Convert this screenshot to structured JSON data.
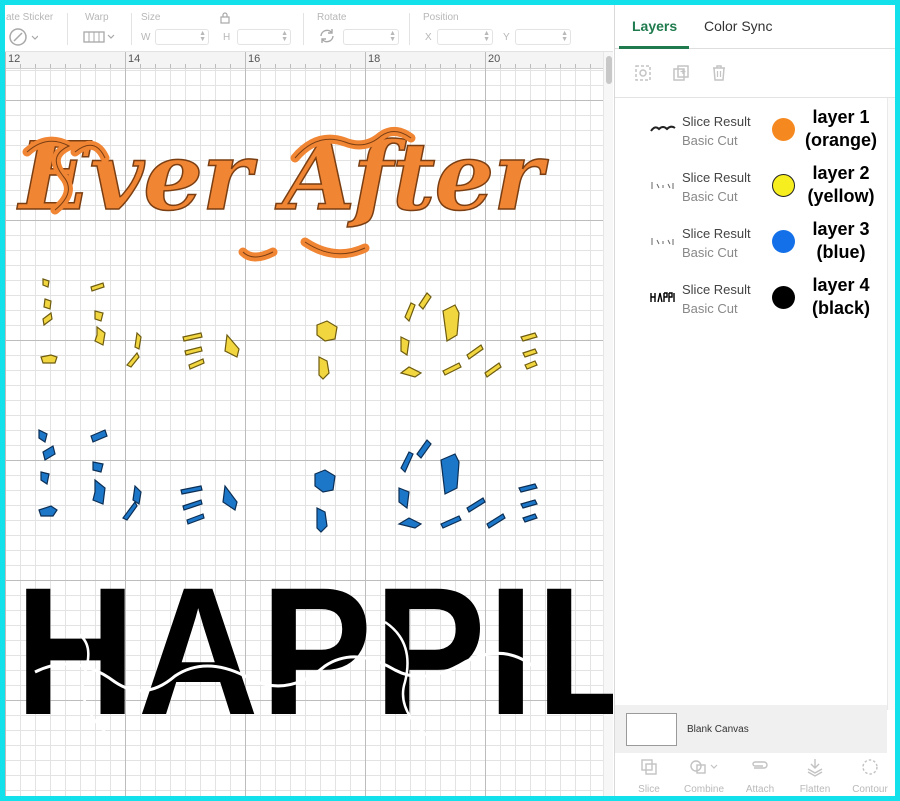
{
  "toolbar": {
    "sticker_label": "ate Sticker",
    "warp_label": "Warp",
    "size_label": "Size",
    "size_w": "W",
    "size_h": "H",
    "rotate_label": "Rotate",
    "position_label": "Position",
    "pos_x": "X",
    "pos_y": "Y"
  },
  "ruler": {
    "ticks": [
      "12",
      "14",
      "16",
      "18",
      "20"
    ]
  },
  "canvas": {
    "orange_text": "Ever After",
    "black_text": "HAPPILY"
  },
  "panel": {
    "tabs": [
      "Layers",
      "Color Sync"
    ],
    "layers": [
      {
        "name": "Slice Result",
        "type": "Basic Cut",
        "tag_line1": "layer 1",
        "tag_line2": "(orange)",
        "color": "#f5891f"
      },
      {
        "name": "Slice Result",
        "type": "Basic Cut",
        "tag_line1": "layer 2",
        "tag_line2": "(yellow)",
        "color": "#f6ee1e"
      },
      {
        "name": "Slice Result",
        "type": "Basic Cut",
        "tag_line1": "layer 3",
        "tag_line2": "(blue)",
        "color": "#1370e8"
      },
      {
        "name": "Slice Result",
        "type": "Basic Cut",
        "tag_line1": "layer 4",
        "tag_line2": "(black)",
        "color": "#000000"
      }
    ],
    "blank_canvas": "Blank Canvas",
    "actions": [
      "Slice",
      "Combine",
      "Attach",
      "Flatten",
      "Contour"
    ]
  },
  "colors": {
    "accent_green": "#1f7b4e",
    "frame_cyan": "#12e0ea",
    "art_orange": "#f08534",
    "art_yellow": "#f2d640",
    "art_blue": "#1d77c9"
  }
}
